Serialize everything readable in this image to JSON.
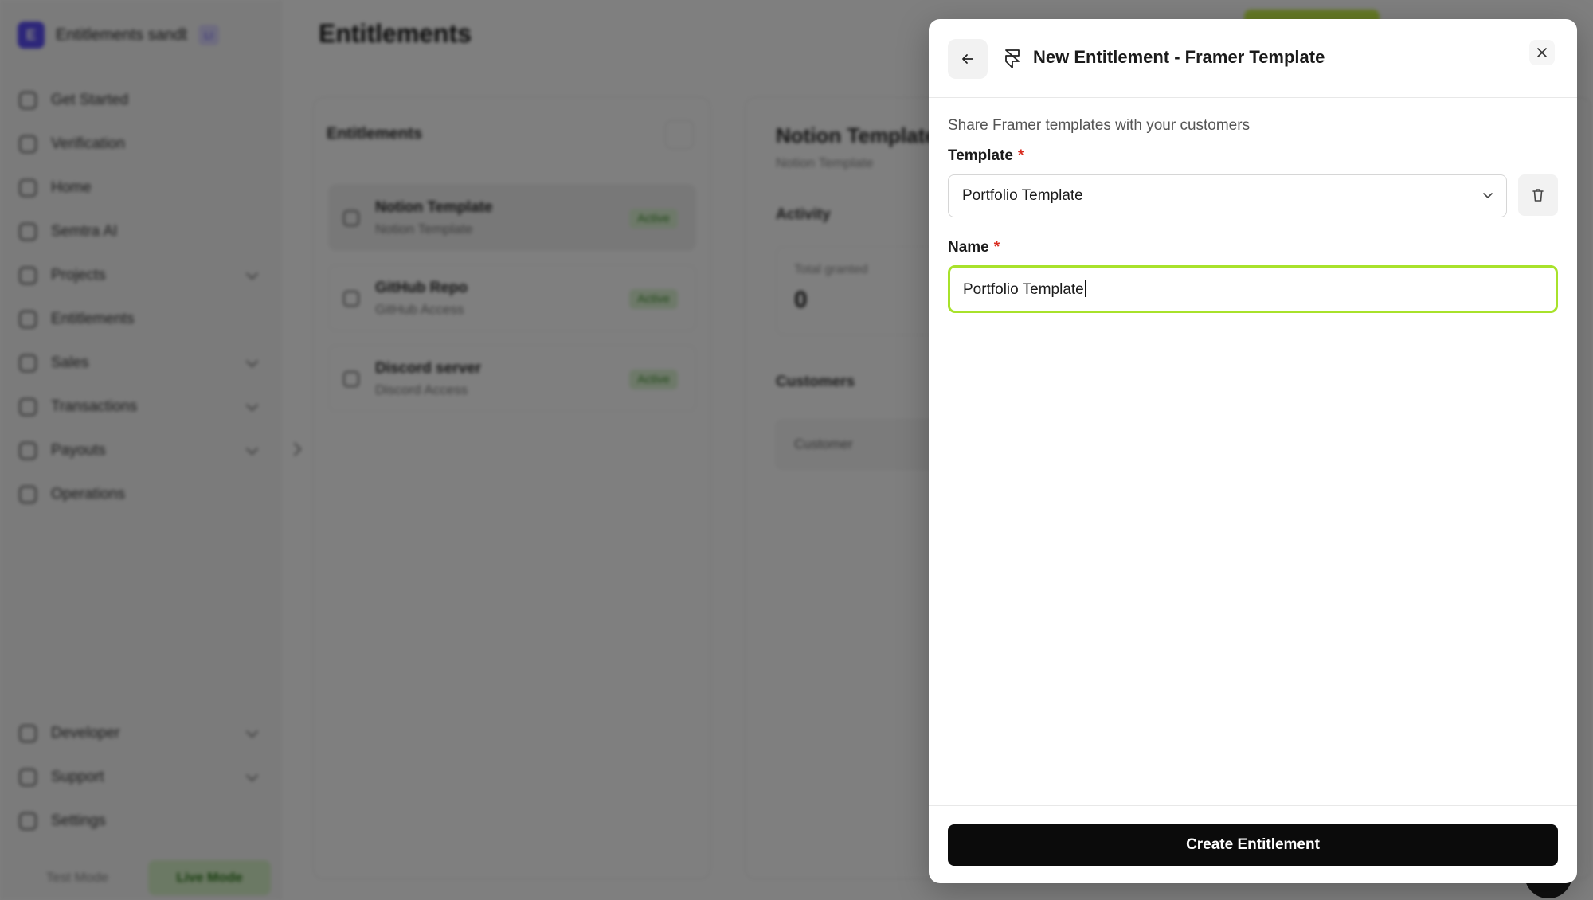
{
  "background": {
    "org_name": "Entitlements sandbox",
    "org_badge": "LI",
    "page_title": "Entitlements",
    "nav": [
      {
        "label": "Get Started"
      },
      {
        "label": "Verification"
      },
      {
        "label": "Home"
      },
      {
        "label": "Semtra AI"
      },
      {
        "label": "Projects"
      },
      {
        "label": "Entitlements"
      },
      {
        "label": "Sales"
      },
      {
        "label": "Transactions"
      },
      {
        "label": "Payouts"
      },
      {
        "label": "Operations"
      }
    ],
    "nav_bottom": [
      {
        "label": "Developer"
      },
      {
        "label": "Support"
      },
      {
        "label": "Settings"
      }
    ],
    "mode_test": "Test Mode",
    "mode_live": "Live Mode",
    "list_title": "Entitlements",
    "entitlements": [
      {
        "title": "Notion Template",
        "subtitle": "Notion Template",
        "status": "Active"
      },
      {
        "title": "GitHub Repo",
        "subtitle": "GitHub Access",
        "status": "Active"
      },
      {
        "title": "Discord server",
        "subtitle": "Discord Access",
        "status": "Active"
      }
    ],
    "detail": {
      "title": "Notion Template",
      "subtitle": "Notion Template",
      "activity_label": "Activity",
      "stat_label": "Total granted",
      "stat_value": "0",
      "customers_label": "Customers",
      "table_header": "Customer"
    }
  },
  "modal": {
    "title": "New Entitlement - Framer Template",
    "description": "Share Framer templates with your customers",
    "template_label": "Template",
    "template_value": "Portfolio Template",
    "name_label": "Name",
    "name_value": "Portfolio Template",
    "required_mark": "*",
    "submit_label": "Create Entitlement",
    "icons": {
      "back": "arrow-left-icon",
      "framer": "framer-icon",
      "close": "close-icon",
      "dropdown": "chevron-down-icon",
      "trash": "trash-icon"
    },
    "accent_color": "#a8e22b"
  }
}
